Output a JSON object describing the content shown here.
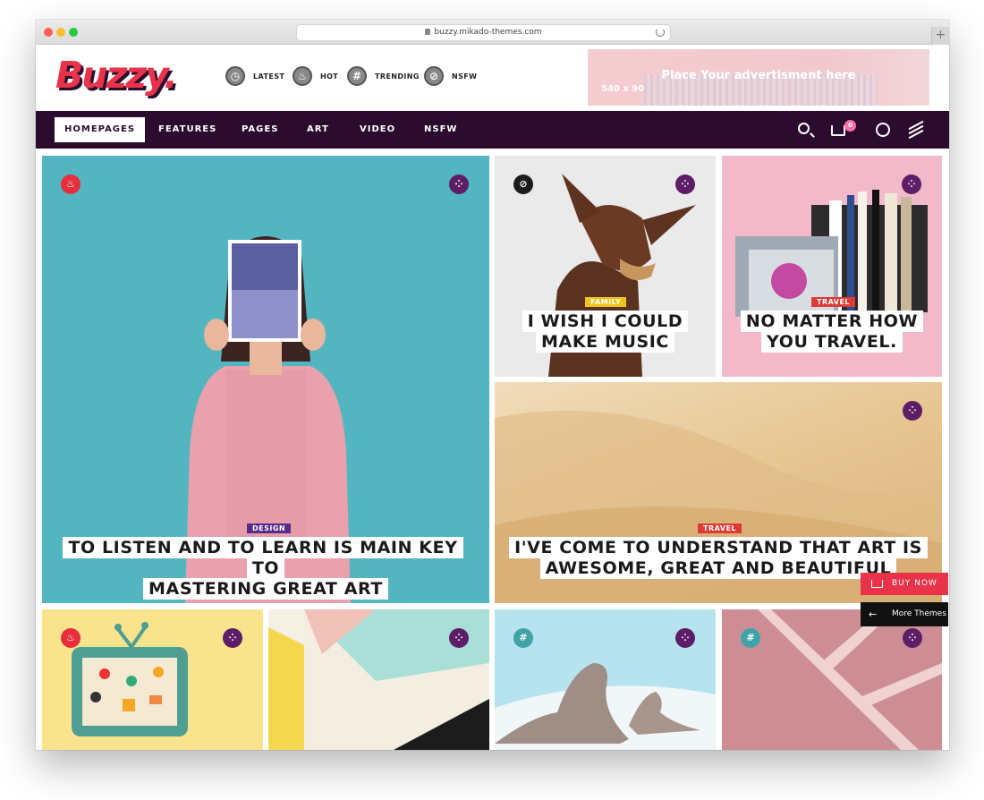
{
  "browser": {
    "url": "buzzy.mikado-themes.com",
    "newtab": "+"
  },
  "header": {
    "logo": "Buzzy.",
    "quick_links": [
      {
        "label": "LATEST",
        "icon": "clock-icon",
        "glyph": "◷"
      },
      {
        "label": "HOT",
        "icon": "flame-icon",
        "glyph": "♨"
      },
      {
        "label": "TRENDING",
        "icon": "hash-icon",
        "glyph": "#"
      },
      {
        "label": "NSFW",
        "icon": "block-icon",
        "glyph": "⊘"
      }
    ],
    "ad": {
      "text": "Place Your advertisment here",
      "size": "540 x 90"
    }
  },
  "nav": {
    "items": [
      "HOMEPAGES",
      "FEATURES",
      "PAGES",
      "ART",
      "VIDEO",
      "NSFW"
    ],
    "active": "HOMEPAGES",
    "cart_count": "0"
  },
  "posts": [
    {
      "category": "DESIGN",
      "title_lines": [
        "TO LISTEN AND TO LEARN IS MAIN KEY TO",
        "MASTERING GREAT ART"
      ],
      "badge": "hot"
    },
    {
      "category": "FAMILY",
      "title_lines": [
        "I WISH I COULD",
        "MAKE MUSIC"
      ],
      "badge": "nsfw"
    },
    {
      "category": "TRAVEL",
      "title_lines": [
        "NO MATTER HOW",
        "YOU TRAVEL."
      ],
      "badge": "none"
    },
    {
      "category": "TRAVEL",
      "title_lines": [
        "I'VE COME TO UNDERSTAND THAT ART IS",
        "AWESOME, GREAT AND BEAUTIFUL"
      ],
      "badge": "none"
    }
  ],
  "colors": {
    "brand": "#e8334a",
    "nav_bg": "#2b0b2e",
    "design_tag": "#5a2a8a",
    "family_tag": "#f0c419",
    "travel_tag": "#e03a36"
  },
  "float": {
    "buy_now": "BUY NOW",
    "more_themes": "More Themes"
  }
}
